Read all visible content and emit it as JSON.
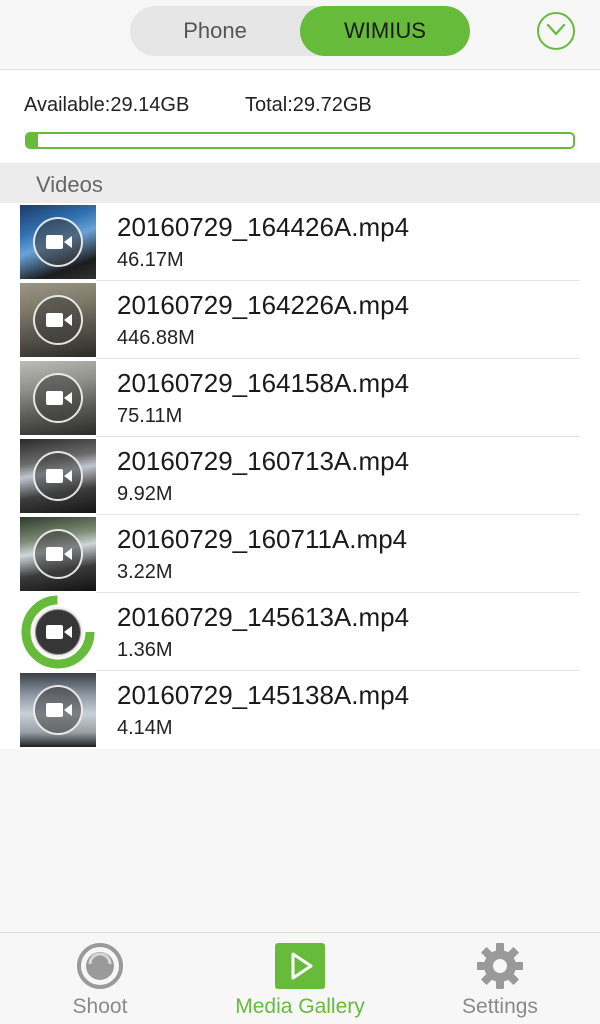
{
  "header": {
    "tabs": [
      {
        "label": "Phone",
        "selected": false
      },
      {
        "label": "WIMIUS",
        "selected": true
      }
    ],
    "confirm_icon": "check-circle-icon"
  },
  "storage": {
    "available": "Available:29.14GB",
    "total": "Total:29.72GB",
    "used_fraction": 0.02
  },
  "section": {
    "title": "Videos"
  },
  "videos": [
    {
      "name": "20160729_164426A.mp4",
      "size": "46.17M"
    },
    {
      "name": "20160729_164226A.mp4",
      "size": "446.88M"
    },
    {
      "name": "20160729_164158A.mp4",
      "size": "75.11M"
    },
    {
      "name": "20160729_160713A.mp4",
      "size": "9.92M"
    },
    {
      "name": "20160729_160711A.mp4",
      "size": "3.22M"
    },
    {
      "name": "20160729_145613A.mp4",
      "size": "1.36M"
    },
    {
      "name": "20160729_145138A.mp4",
      "size": "4.14M"
    }
  ],
  "bottom_nav": [
    {
      "label": "Shoot",
      "icon": "shutter-icon",
      "active": false
    },
    {
      "label": "Media Gallery",
      "icon": "play-icon",
      "active": true
    },
    {
      "label": "Settings",
      "icon": "gear-icon",
      "active": false
    }
  ],
  "colors": {
    "accent": "#66bb3a"
  }
}
